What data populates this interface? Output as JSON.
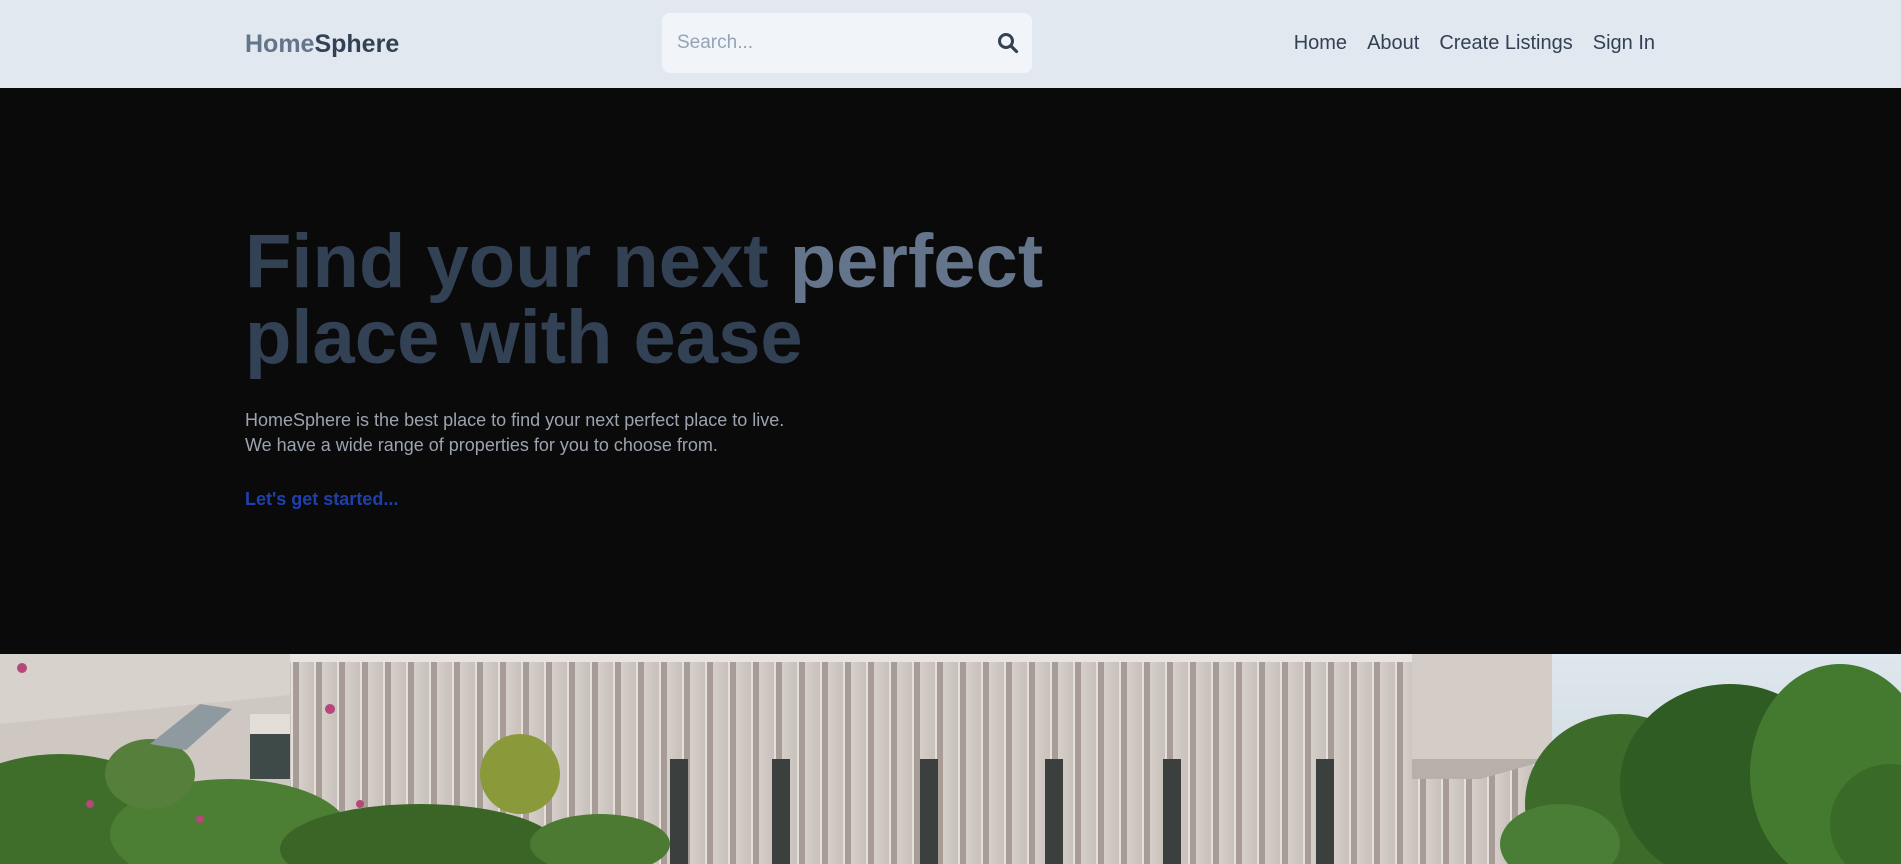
{
  "brand": {
    "part1": "Home",
    "part2": "Sphere"
  },
  "search": {
    "placeholder": "Search...",
    "icon": "search-icon"
  },
  "nav": {
    "items": [
      {
        "label": "Home"
      },
      {
        "label": "About"
      },
      {
        "label": "Create Listings"
      },
      {
        "label": "Sign In"
      }
    ]
  },
  "hero": {
    "headline_part1": "Find your next ",
    "headline_accent": "perfect",
    "headline_part2": "place with ease",
    "subtext_line1": "HomeSphere is the best place to find your next perfect place to live.",
    "subtext_line2": "We have a wide range of properties for you to choose from.",
    "cta_label": "Let's get started..."
  },
  "colors": {
    "header_bg": "#e2e8f0",
    "logo_light": "#64748b",
    "logo_dark": "#334155",
    "hero_bg": "#0a0a0b",
    "headline": "#334155",
    "headline_accent": "#64748b",
    "subtext": "#9ca3af",
    "cta": "#1e40af"
  }
}
